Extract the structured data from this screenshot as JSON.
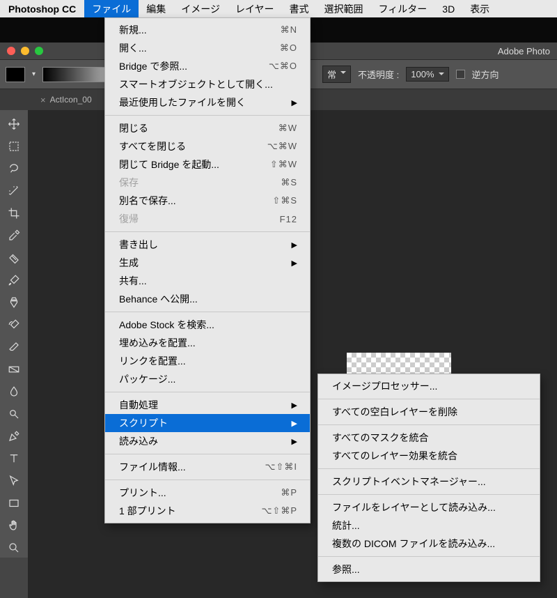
{
  "menubar": {
    "app": "Photoshop CC",
    "items": [
      "ファイル",
      "編集",
      "イメージ",
      "レイヤー",
      "書式",
      "選択範囲",
      "フィルター",
      "3D",
      "表示"
    ],
    "activeIndex": 0
  },
  "titlebar": {
    "title": "Adobe Photo"
  },
  "optbar": {
    "mode": "常",
    "opacity_label": "不透明度 :",
    "opacity_value": "100%",
    "reverse_label": "逆方向"
  },
  "tab": {
    "name": "ActIcon_00",
    "close": "×"
  },
  "fileMenu": [
    {
      "label": "新規...",
      "shortcut": "⌘N"
    },
    {
      "label": "開く...",
      "shortcut": "⌘O"
    },
    {
      "label": "Bridge で参照...",
      "shortcut": "⌥⌘O"
    },
    {
      "label": "スマートオブジェクトとして開く..."
    },
    {
      "label": "最近使用したファイルを開く",
      "arrow": true
    },
    {
      "sep": true
    },
    {
      "label": "閉じる",
      "shortcut": "⌘W"
    },
    {
      "label": "すべてを閉じる",
      "shortcut": "⌥⌘W"
    },
    {
      "label": "閉じて Bridge を起動...",
      "shortcut": "⇧⌘W"
    },
    {
      "label": "保存",
      "shortcut": "⌘S",
      "disabled": true
    },
    {
      "label": "別名で保存...",
      "shortcut": "⇧⌘S"
    },
    {
      "label": "復帰",
      "shortcut": "F12",
      "disabled": true
    },
    {
      "sep": true
    },
    {
      "label": "書き出し",
      "arrow": true
    },
    {
      "label": "生成",
      "arrow": true
    },
    {
      "label": "共有..."
    },
    {
      "label": "Behance へ公開..."
    },
    {
      "sep": true
    },
    {
      "label": "Adobe Stock を検索..."
    },
    {
      "label": "埋め込みを配置..."
    },
    {
      "label": "リンクを配置..."
    },
    {
      "label": "パッケージ..."
    },
    {
      "sep": true
    },
    {
      "label": "自動処理",
      "arrow": true
    },
    {
      "label": "スクリプト",
      "arrow": true,
      "highlight": true
    },
    {
      "label": "読み込み",
      "arrow": true
    },
    {
      "sep": true
    },
    {
      "label": "ファイル情報...",
      "shortcut": "⌥⇧⌘I"
    },
    {
      "sep": true
    },
    {
      "label": "プリント...",
      "shortcut": "⌘P"
    },
    {
      "label": "1 部プリント",
      "shortcut": "⌥⇧⌘P"
    }
  ],
  "scriptMenu": [
    {
      "label": "イメージプロセッサー..."
    },
    {
      "sep": true
    },
    {
      "label": "すべての空白レイヤーを削除"
    },
    {
      "sep": true
    },
    {
      "label": "すべてのマスクを統合"
    },
    {
      "label": "すべてのレイヤー効果を統合"
    },
    {
      "sep": true
    },
    {
      "label": "スクリプトイベントマネージャー..."
    },
    {
      "sep": true
    },
    {
      "label": "ファイルをレイヤーとして読み込み..."
    },
    {
      "label": "統計..."
    },
    {
      "label": "複数の DICOM ファイルを読み込み..."
    },
    {
      "sep": true
    },
    {
      "label": "参照..."
    }
  ],
  "tools": [
    "move",
    "marquee",
    "lasso",
    "magic-wand",
    "crop",
    "eyedropper",
    "spot-heal",
    "brush",
    "clone",
    "history-brush",
    "eraser",
    "gradient",
    "blur",
    "dodge",
    "pen",
    "type",
    "path-select",
    "rectangle",
    "hand",
    "zoom"
  ]
}
